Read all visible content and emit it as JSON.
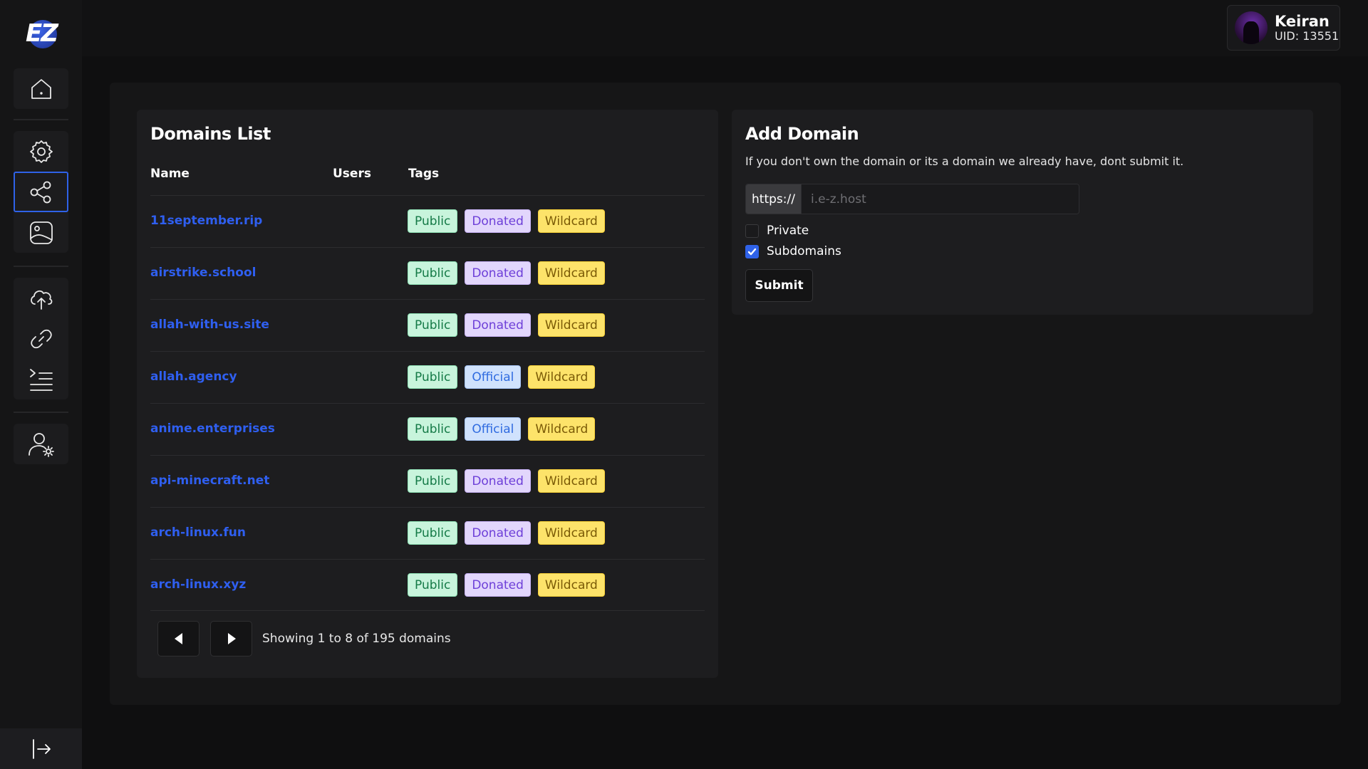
{
  "app": {
    "logo_text": "EZ"
  },
  "sidebar": {
    "items": [
      {
        "name": "home",
        "icon": "home-icon"
      },
      {
        "name": "settings",
        "icon": "gear-icon"
      },
      {
        "name": "domains",
        "icon": "share-nodes-icon",
        "active": true
      },
      {
        "name": "gallery",
        "icon": "image-icon"
      },
      {
        "name": "upload",
        "icon": "cloud-upload-icon"
      },
      {
        "name": "links",
        "icon": "link-icon"
      },
      {
        "name": "pastes",
        "icon": "list-indent-icon"
      },
      {
        "name": "account",
        "icon": "user-gear-icon"
      }
    ],
    "logout_icon": "logout-icon"
  },
  "user": {
    "name": "Keiran",
    "uid": "UID: 13551"
  },
  "domains": {
    "title": "Domains List",
    "headers": {
      "name": "Name",
      "users": "Users",
      "tags": "Tags"
    },
    "rows": [
      {
        "name": "11september.rip",
        "tags": [
          "Public",
          "Donated",
          "Wildcard"
        ]
      },
      {
        "name": "airstrike.school",
        "tags": [
          "Public",
          "Donated",
          "Wildcard"
        ]
      },
      {
        "name": "allah-with-us.site",
        "tags": [
          "Public",
          "Donated",
          "Wildcard"
        ]
      },
      {
        "name": "allah.agency",
        "tags": [
          "Public",
          "Official",
          "Wildcard"
        ]
      },
      {
        "name": "anime.enterprises",
        "tags": [
          "Public",
          "Official",
          "Wildcard"
        ]
      },
      {
        "name": "api-minecraft.net",
        "tags": [
          "Public",
          "Donated",
          "Wildcard"
        ]
      },
      {
        "name": "arch-linux.fun",
        "tags": [
          "Public",
          "Donated",
          "Wildcard"
        ]
      },
      {
        "name": "arch-linux.xyz",
        "tags": [
          "Public",
          "Donated",
          "Wildcard"
        ]
      }
    ],
    "pagination_text": "Showing 1 to 8 of 195 domains"
  },
  "add_domain": {
    "title": "Add Domain",
    "description": "If you don't own the domain or its a domain we already have, dont submit it.",
    "prefix": "https://",
    "placeholder": "i.e-z.host",
    "value": "",
    "private_label": "Private",
    "private_checked": false,
    "subdomains_label": "Subdomains",
    "subdomains_checked": true,
    "submit_label": "Submit"
  },
  "colors": {
    "accent": "#2f62e8",
    "link": "#2f5ff0",
    "tag_public_bg": "#c8f4dc",
    "tag_donated_bg": "#e2d6fc",
    "tag_official_bg": "#d0e2fd",
    "tag_wildcard_bg": "#fde36a"
  }
}
